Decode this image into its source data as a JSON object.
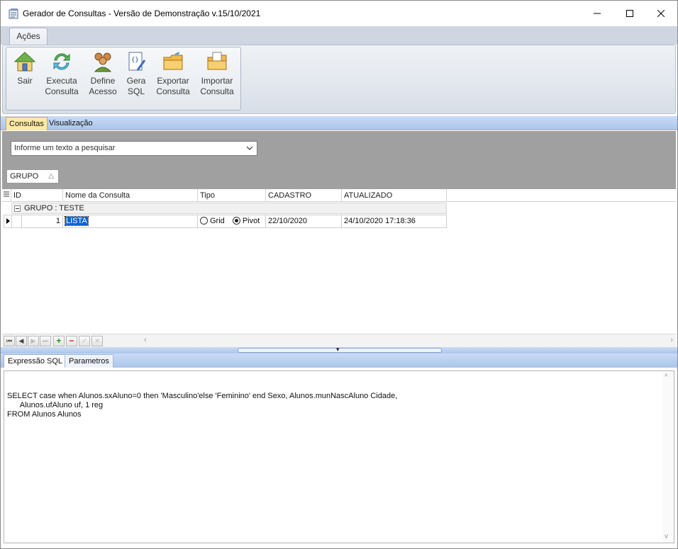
{
  "window": {
    "title": "Gerador de Consultas - Versão de Demonstração v.15/10/2021"
  },
  "ribbon": {
    "tab_label": "Ações",
    "buttons": [
      {
        "label": "Sair",
        "icon": "home-icon"
      },
      {
        "label": "Executa\nConsulta",
        "icon": "refresh-icon"
      },
      {
        "label": "Define\nAcesso",
        "icon": "users-icon"
      },
      {
        "label": "Gera\nSQL",
        "icon": "code-document-icon"
      },
      {
        "label": "Exportar\nConsulta",
        "icon": "folder-export-icon"
      },
      {
        "label": "Importar\nConsulta",
        "icon": "folder-import-icon"
      }
    ]
  },
  "main_tabs": [
    "Consultas",
    "Visualização"
  ],
  "search": {
    "placeholder": "Informe um texto a pesquisar"
  },
  "group_by": {
    "label": "GRUPO"
  },
  "grid": {
    "columns": [
      "ID",
      "Nome da Consulta",
      "Tipo",
      "CADASTRO",
      "ATUALIZADO"
    ],
    "group_row": "GRUPO : TESTE",
    "rows": [
      {
        "id": "1",
        "name": "LISTA",
        "tipo_options": [
          "Grid",
          "Pivot"
        ],
        "tipo_selected": "Pivot",
        "cadastro": "22/10/2020",
        "atualizado": "24/10/2020 17:18:36"
      }
    ]
  },
  "bottom_tabs": [
    "Expressão SQL",
    "Parametros"
  ],
  "sql": {
    "text": "SELECT case when Alunos.sxAluno=0 then 'Masculino'else 'Feminino' end Sexo, Alunos.munNascAluno Cidade,\n      Alunos.ufAluno uf, 1 reg\nFROM Alunos Alunos"
  }
}
